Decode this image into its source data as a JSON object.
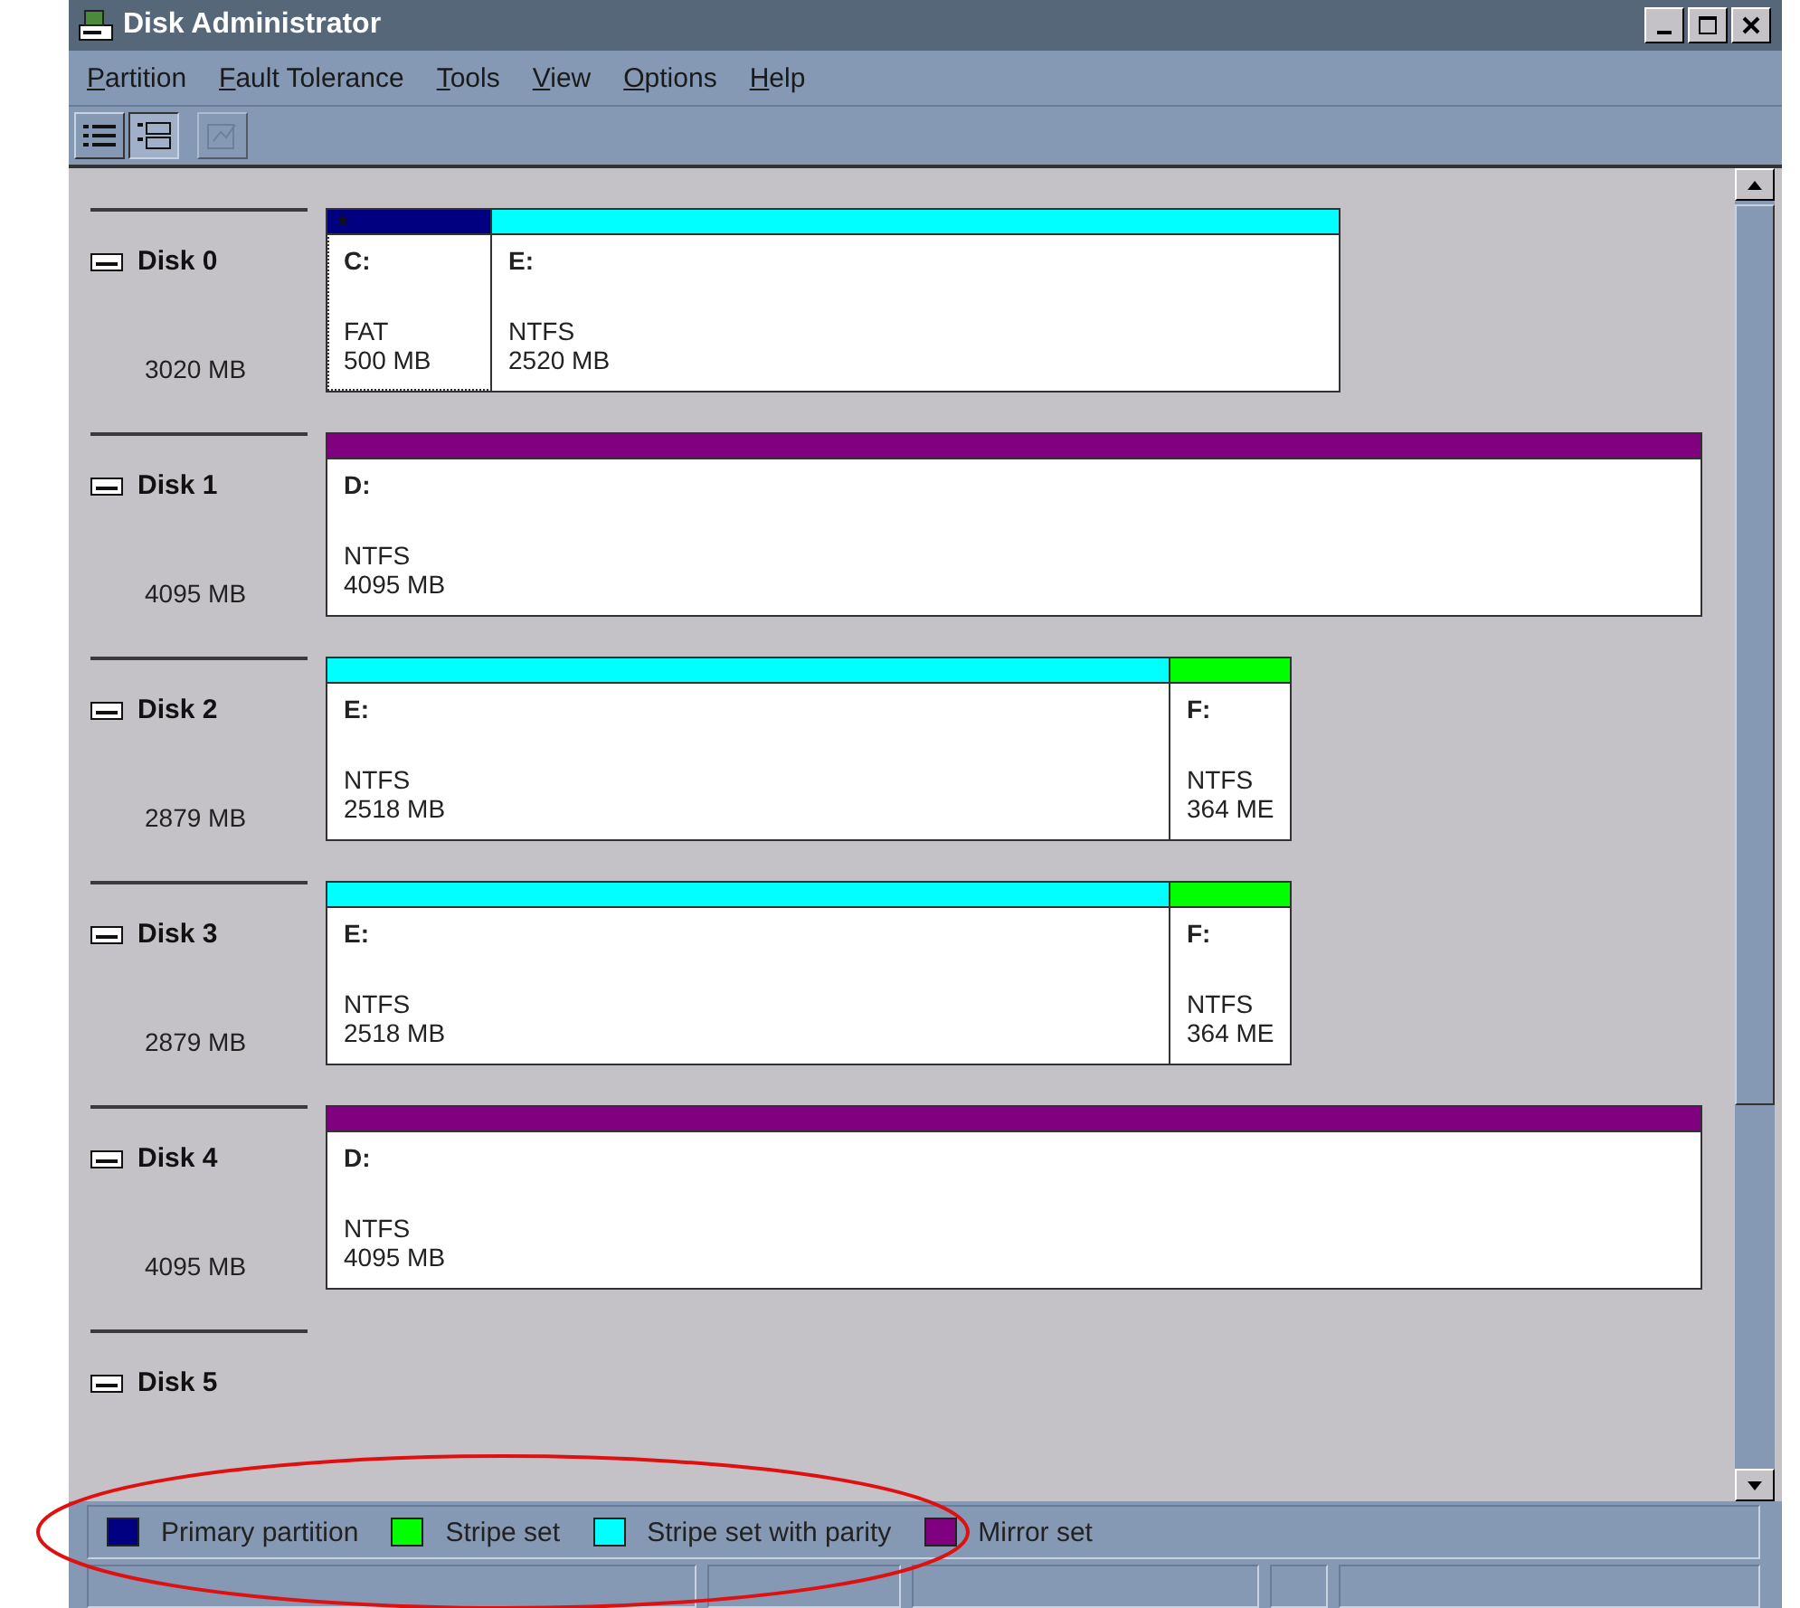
{
  "window": {
    "title": "Disk Administrator"
  },
  "menu": [
    {
      "label": "Partition"
    },
    {
      "label": "Fault Tolerance"
    },
    {
      "label": "Tools"
    },
    {
      "label": "View"
    },
    {
      "label": "Options"
    },
    {
      "label": "Help"
    }
  ],
  "toolbar": [
    {
      "kind": "list",
      "selected": false,
      "disabled": false
    },
    {
      "kind": "detail",
      "selected": true,
      "disabled": false
    },
    {
      "kind": "properties",
      "selected": false,
      "disabled": true
    }
  ],
  "disks": [
    {
      "name": "Disk 0",
      "size": "3020 MB",
      "partitions": [
        {
          "letter": "C:",
          "filesystem": "FAT",
          "size": "500 MB",
          "color": "#000080",
          "selected": true,
          "active": true
        },
        {
          "letter": "E:",
          "filesystem": "NTFS",
          "size": "2520 MB",
          "color": "#00ffff",
          "selected": false,
          "active": false
        }
      ]
    },
    {
      "name": "Disk 1",
      "size": "4095 MB",
      "partitions": [
        {
          "letter": "D:",
          "filesystem": "NTFS",
          "size": "4095 MB",
          "color": "#800080",
          "selected": false,
          "active": false
        }
      ]
    },
    {
      "name": "Disk 2",
      "size": "2879 MB",
      "partitions": [
        {
          "letter": "E:",
          "filesystem": "NTFS",
          "size": "2518 MB",
          "color": "#00ffff",
          "selected": false,
          "active": false
        },
        {
          "letter": "F:",
          "filesystem": "NTFS",
          "size": "364 ME",
          "color": "#00ff00",
          "selected": false,
          "active": false
        }
      ]
    },
    {
      "name": "Disk 3",
      "size": "2879 MB",
      "partitions": [
        {
          "letter": "E:",
          "filesystem": "NTFS",
          "size": "2518 MB",
          "color": "#00ffff",
          "selected": false,
          "active": false
        },
        {
          "letter": "F:",
          "filesystem": "NTFS",
          "size": "364 ME",
          "color": "#00ff00",
          "selected": false,
          "active": false
        }
      ]
    },
    {
      "name": "Disk 4",
      "size": "4095 MB",
      "partitions": [
        {
          "letter": "D:",
          "filesystem": "NTFS",
          "size": "4095 MB",
          "color": "#800080",
          "selected": false,
          "active": false
        }
      ]
    },
    {
      "name": "Disk 5"
    }
  ],
  "legend": [
    {
      "label": "Primary partition",
      "color": "#000080"
    },
    {
      "label": "Stripe set",
      "color": "#00ff00"
    },
    {
      "label": "Stripe set with parity",
      "color": "#00ffff"
    },
    {
      "label": "Mirror set",
      "color": "#800080"
    }
  ],
  "annotation": {
    "kind": "ellipse"
  }
}
